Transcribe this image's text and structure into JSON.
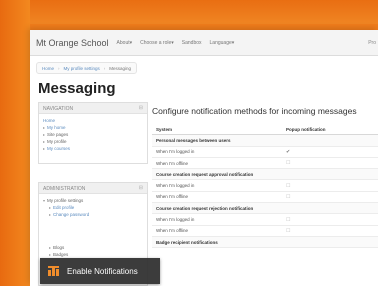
{
  "navbar": {
    "brand": "Mt Orange School",
    "links": [
      "About▾",
      "Choose a role▾",
      "Sandbox",
      "Language▾"
    ],
    "right_text": "Pro"
  },
  "breadcrumb": [
    "Home",
    "My profile settings",
    "Messaging"
  ],
  "page_title": "Messaging",
  "navigation_block": {
    "title": "NAVIGATION",
    "items": [
      "Home",
      "My home",
      "Site pages",
      "My profile",
      "My courses"
    ]
  },
  "admin_block": {
    "title": "ADMINISTRATION",
    "items": [
      "My profile settings",
      "Edit profile",
      "Change password",
      "Blogs",
      "Badges"
    ]
  },
  "main": {
    "title": "Configure notification methods for incoming messages",
    "columns": [
      "System",
      "Popup notification"
    ],
    "rows": [
      {
        "type": "section",
        "label": "Personal messages between users"
      },
      {
        "type": "row",
        "label": "When I'm logged in",
        "checked": true
      },
      {
        "type": "row",
        "label": "When I'm offline",
        "checked": false
      },
      {
        "type": "section",
        "label": "Course creation request approval notification"
      },
      {
        "type": "row",
        "label": "When I'm logged in",
        "checked": false
      },
      {
        "type": "row",
        "label": "When I'm offline",
        "checked": false
      },
      {
        "type": "section",
        "label": "Course creation request rejection notification"
      },
      {
        "type": "row",
        "label": "When I'm logged in",
        "checked": false
      },
      {
        "type": "row",
        "label": "When I'm offline",
        "checked": false
      },
      {
        "type": "section",
        "label": "Badge recipient notifications"
      }
    ]
  },
  "overlay": {
    "label": "Enable Notifications",
    "icon": "moodle-logo-icon"
  },
  "colors": {
    "background": "#f07c1b",
    "link": "#5b8bbf",
    "overlay": "#2d2d2d"
  }
}
